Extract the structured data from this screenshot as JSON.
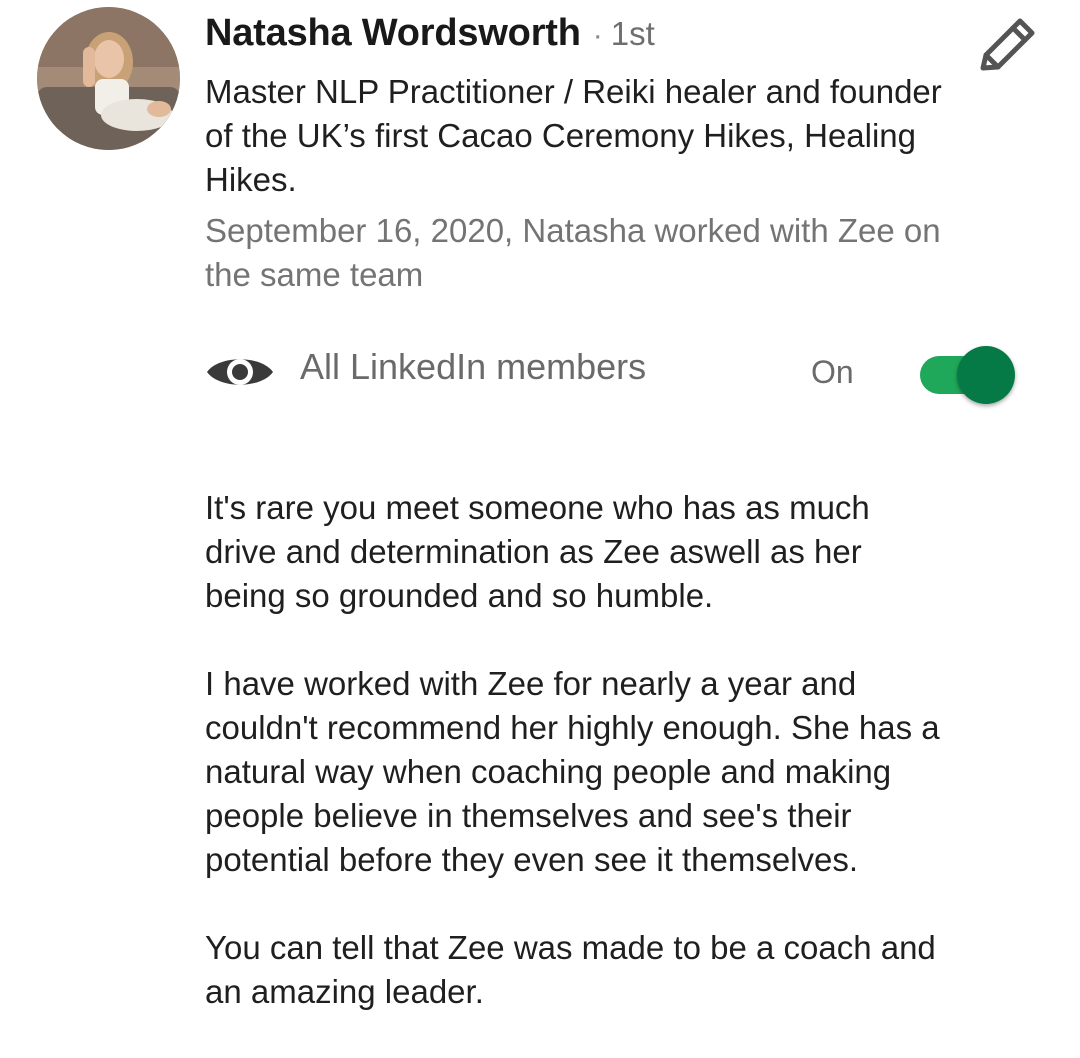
{
  "recommender": {
    "name": "Natasha Wordsworth",
    "separator": "·",
    "connection_degree": "1st",
    "headline": "Master NLP Practitioner / Reiki healer and founder of the UK’s first Cacao Ceremony Hikes, Healing Hikes.",
    "relationship": "September 16, 2020, Natasha worked with Zee on the same team",
    "avatar_icon": "profile-photo"
  },
  "toolbar": {
    "edit_icon": "pencil-icon"
  },
  "visibility": {
    "icon": "eye-icon",
    "label": "All LinkedIn members",
    "state_label": "On",
    "toggle_on": true,
    "track_color": "#1fa85a",
    "thumb_color": "#067a46"
  },
  "recommendation": {
    "paragraphs": [
      "It's rare you meet someone who has as much\ndrive and determination as Zee aswell as her\nbeing so grounded and so humble.",
      "I have worked with Zee for nearly a year and\ncouldn't recommend her highly enough. She has a\nnatural way when coaching people and making\npeople believe in themselves and see's their\npotential before they even see it themselves.",
      "You can tell that Zee was made to be a coach and\nan amazing leader."
    ]
  }
}
